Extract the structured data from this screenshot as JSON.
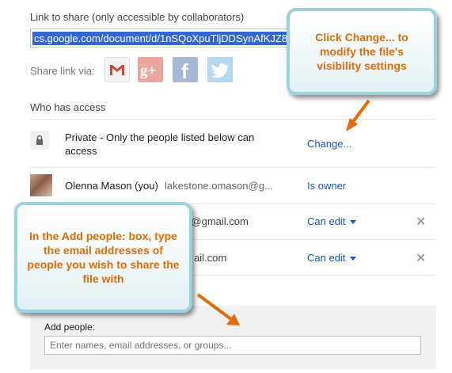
{
  "share": {
    "link_label": "Link to share (only accessible by collaborators)",
    "link_value": "cs.google.com/document/d/1nSQoXpuTljDDSynAfKJZ8",
    "share_via_label": "Share link via:",
    "icons": [
      "gmail-icon",
      "google-plus-icon",
      "facebook-icon",
      "twitter-icon"
    ]
  },
  "access": {
    "heading": "Who has access",
    "private_text": "Private - Only the people listed below can access",
    "change_label": "Change...",
    "owner": {
      "name": "Olenna Mason (you)",
      "email": "lakestone.omason@g...",
      "role": "Is owner"
    },
    "collaborators": [
      {
        "email": "ic@gmail.com",
        "role": "Can edit"
      },
      {
        "email": "ail.com",
        "role": "Can edit"
      }
    ]
  },
  "add_people": {
    "label": "Add people:",
    "placeholder": "Enter names, email addresses, or groups..."
  },
  "callouts": {
    "change": "Click Change... to modify the file's visibility settings",
    "add": "In the Add people: box, type the email addresses of people you wish to share the file with"
  },
  "colors": {
    "link": "#1155cc",
    "callout_text": "#e36c09",
    "callout_border": "#9ad3de",
    "arrow": "#e36c09"
  }
}
